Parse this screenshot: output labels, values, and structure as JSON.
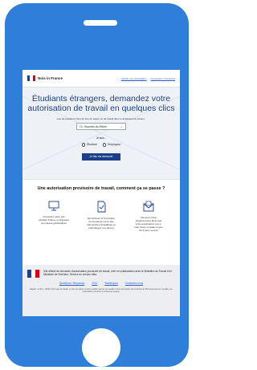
{
  "header": {
    "brand": "Nois in France",
    "links": [
      "Vérifier une autorisation",
      "Connexion / Inscription"
    ]
  },
  "hero": {
    "title": "Étudiants étrangers, demandez votre autorisation de travail en quelques clics",
    "hint": "Lieu de résidence (lieu de titre de séjour ou de travail dans le département suivant :",
    "department": "13 - Bouches-du-Rhône",
    "iam_label": "Je suis...",
    "roles": [
      "Étudiant",
      "Employeur"
    ],
    "cta": "Je fais ma demande"
  },
  "steps": {
    "title": "Une autorisation provisoire de travail, comment ça se passe ?",
    "items": [
      {
        "icon": "monitor-icon",
        "text": "Consultez notre site étudiant France et préparez vos pièces justificatives"
      },
      {
        "icon": "document-check-icon",
        "text": "Remplissez le formulaire de demande sur le site Démarches Simplifiées et téléchargez vos pièces"
      },
      {
        "icon": "mail-icon",
        "text": "Recevez l'état d'avancement ainsi que votre autorisation par e-mail, dans un délai moyen de 5 jours ouvrés"
      }
    ]
  },
  "footer": {
    "text": "Site officiel de demande d'autorisation provisoire de travail, créé en collaboration avec le Ministère du Travail et le Ministère de l'Intérieur. Service en version bêta.",
    "links": [
      "Questions / Réponses",
      "CGU",
      "Statistiques",
      "Contactez-nous"
    ],
    "legal": "Rappel : le titre I, L5221-5 du Code du travail. Le titre de séjour mention étudiant permet de travailler à titre accessoire dans la limite de 964 heures par an. Au-delà, une autorisation provisoire de travail est requise."
  }
}
